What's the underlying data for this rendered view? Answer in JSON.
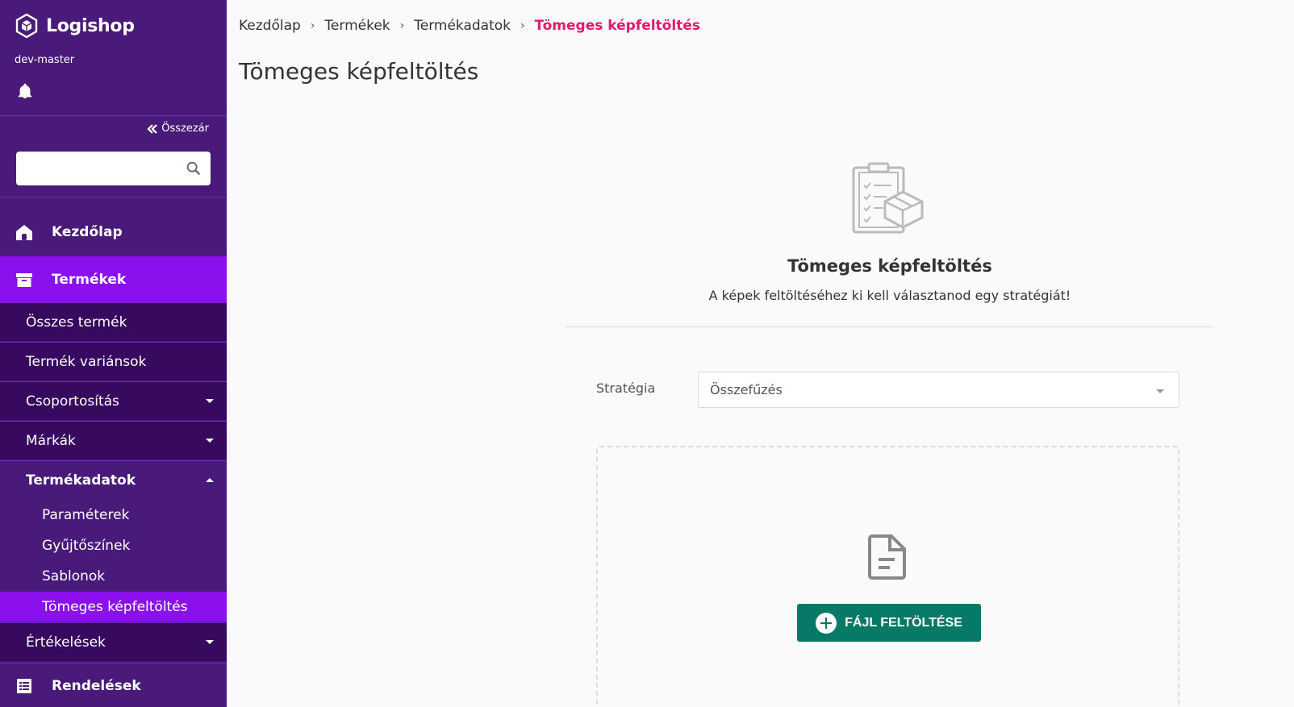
{
  "sidebar": {
    "brand": "Logishop",
    "environment": "dev-master",
    "collapse_label": "Összezár",
    "search_placeholder": "",
    "main_items": [
      {
        "label": "Kezdőlap",
        "icon": "home-icon"
      },
      {
        "label": "Termékek",
        "icon": "archive-box-icon",
        "active": true
      },
      {
        "label": "Rendelések",
        "icon": "orders-icon"
      }
    ],
    "sub_items": [
      {
        "label": "Összes termék"
      },
      {
        "label": "Termék variánsok"
      },
      {
        "label": "Csoportosítás",
        "expandable": true
      },
      {
        "label": "Márkák",
        "expandable": true
      },
      {
        "label": "Termékadatok",
        "expanded": true
      },
      {
        "label": "Értékelések",
        "expandable": true
      }
    ],
    "leaf_items": [
      {
        "label": "Paraméterek"
      },
      {
        "label": "Gyűjtőszínek"
      },
      {
        "label": "Sablonok"
      },
      {
        "label": "Tömeges képfeltöltés",
        "active": true
      }
    ]
  },
  "breadcrumb": [
    "Kezdőlap",
    "Termékek",
    "Termékadatok",
    "Tömeges képfeltöltés"
  ],
  "page": {
    "title": "Tömeges képfeltöltés",
    "hero_title": "Tömeges képfeltöltés",
    "hero_subtitle": "A képek feltöltéséhez ki kell választanod egy stratégiát!",
    "strategy_label": "Stratégia",
    "strategy_value": "Összefűzés",
    "upload_button": "FÁJL FELTÖLTÉSE"
  },
  "colors": {
    "sidebar_bg": "#4a1a7a",
    "sidebar_active": "#8a11ee",
    "submenu_bg": "#380a5f",
    "breadcrumb_active": "#e4176f",
    "upload_button": "#067a66"
  }
}
